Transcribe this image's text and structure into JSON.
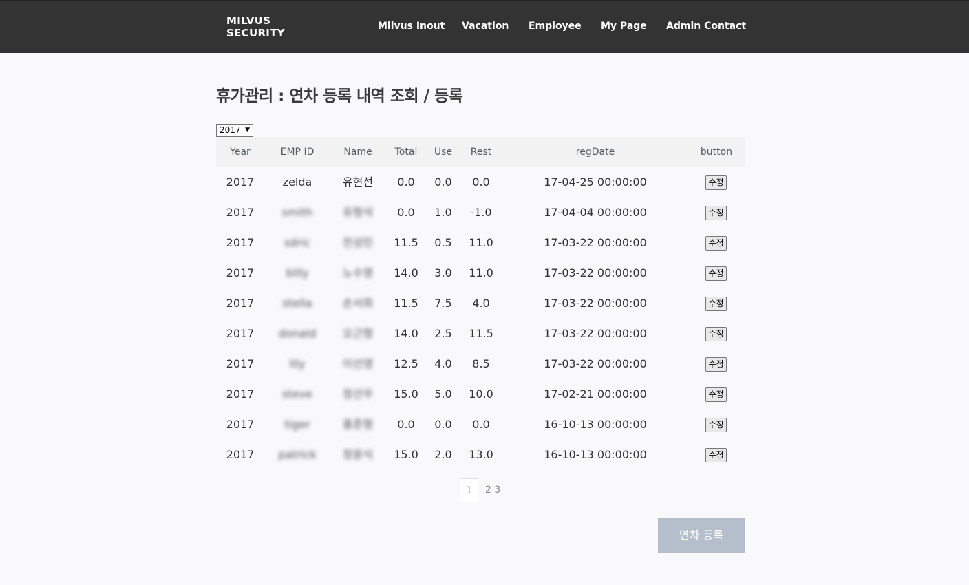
{
  "nav": {
    "brand_line1": "MILVUS",
    "brand_line2": "SECURITY",
    "links": [
      "Milvus Inout",
      "Vacation",
      "Employee",
      "My Page",
      "Admin Contact"
    ]
  },
  "page": {
    "title": "휴가관리 : 연차 등록 내역 조회 / 등록",
    "year_select": "2017"
  },
  "table": {
    "headers": [
      "Year",
      "EMP ID",
      "Name",
      "Total",
      "Use",
      "Rest",
      "regDate",
      "button"
    ],
    "button_label": "수정",
    "rows": [
      {
        "year": "2017",
        "emp_id": "zelda",
        "name": "유현선",
        "total": "0.0",
        "use": "0.0",
        "rest": "0.0",
        "reg_date": "17-04-25 00:00:00"
      },
      {
        "year": "2017",
        "emp_id": "smith",
        "name": "유형석",
        "total": "0.0",
        "use": "1.0",
        "rest": "-1.0",
        "reg_date": "17-04-04 00:00:00"
      },
      {
        "year": "2017",
        "emp_id": "sdric",
        "name": "전성민",
        "total": "11.5",
        "use": "0.5",
        "rest": "11.0",
        "reg_date": "17-03-22 00:00:00"
      },
      {
        "year": "2017",
        "emp_id": "billy",
        "name": "노수영",
        "total": "14.0",
        "use": "3.0",
        "rest": "11.0",
        "reg_date": "17-03-22 00:00:00"
      },
      {
        "year": "2017",
        "emp_id": "stella",
        "name": "손서희",
        "total": "11.5",
        "use": "7.5",
        "rest": "4.0",
        "reg_date": "17-03-22 00:00:00"
      },
      {
        "year": "2017",
        "emp_id": "donald",
        "name": "오근형",
        "total": "14.0",
        "use": "2.5",
        "rest": "11.5",
        "reg_date": "17-03-22 00:00:00"
      },
      {
        "year": "2017",
        "emp_id": "lily",
        "name": "이선영",
        "total": "12.5",
        "use": "4.0",
        "rest": "8.5",
        "reg_date": "17-03-22 00:00:00"
      },
      {
        "year": "2017",
        "emp_id": "steve",
        "name": "정선우",
        "total": "15.0",
        "use": "5.0",
        "rest": "10.0",
        "reg_date": "17-02-21 00:00:00"
      },
      {
        "year": "2017",
        "emp_id": "tiger",
        "name": "홍준형",
        "total": "0.0",
        "use": "0.0",
        "rest": "0.0",
        "reg_date": "16-10-13 00:00:00"
      },
      {
        "year": "2017",
        "emp_id": "patrick",
        "name": "정윤식",
        "total": "15.0",
        "use": "2.0",
        "rest": "13.0",
        "reg_date": "16-10-13 00:00:00"
      }
    ]
  },
  "pagination": {
    "current": "1",
    "others": "2 3"
  },
  "register_button": "연차 등록"
}
